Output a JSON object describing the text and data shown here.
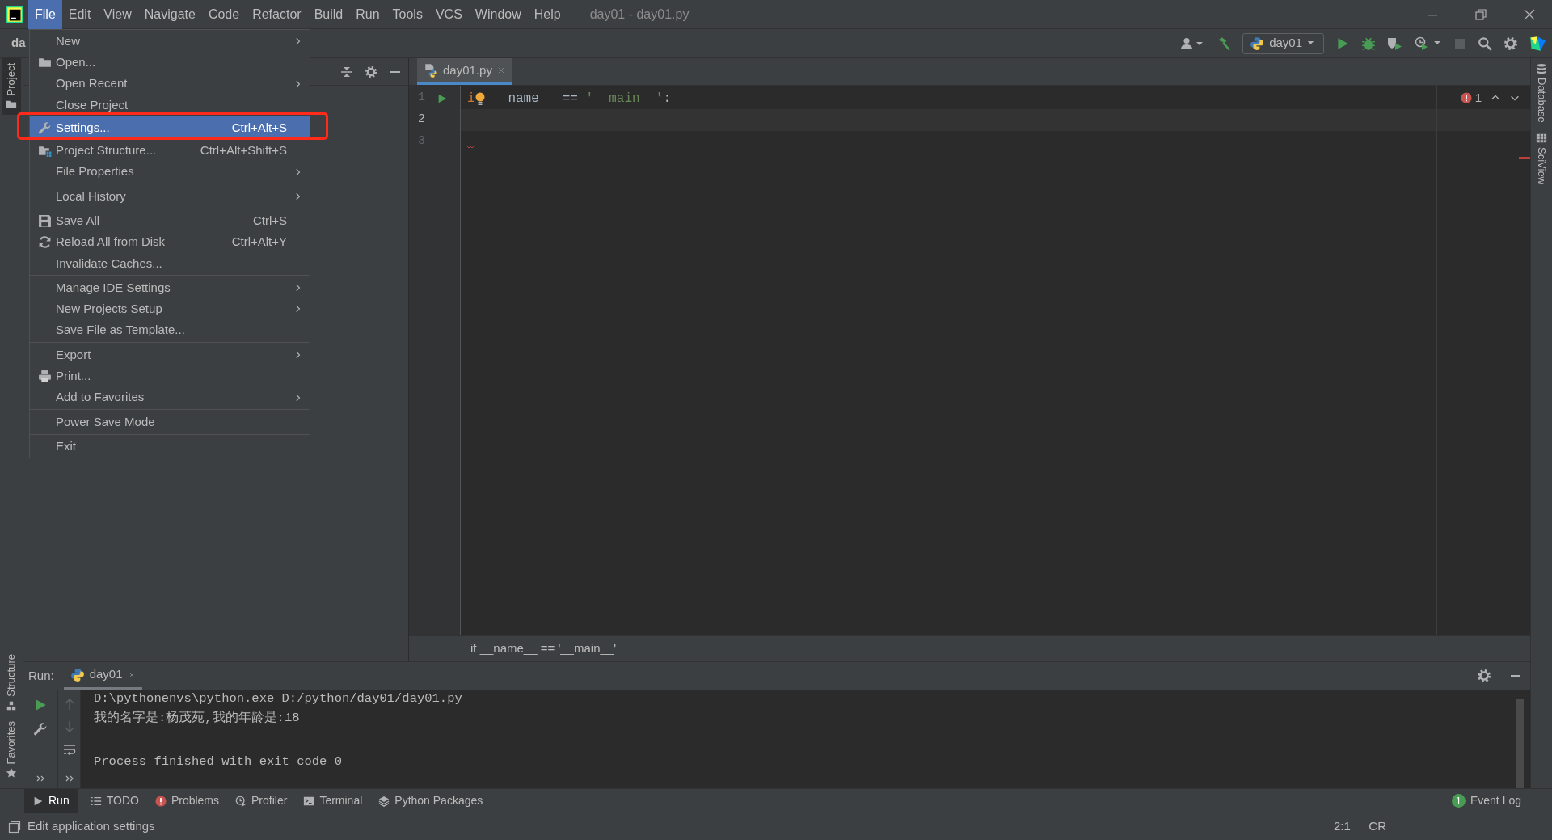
{
  "window": {
    "title": "day01 - day01.py"
  },
  "menu_bar": [
    {
      "label": "File",
      "selected": true
    },
    {
      "label": "Edit",
      "selected": false
    },
    {
      "label": "View",
      "selected": false
    },
    {
      "label": "Navigate",
      "selected": false
    },
    {
      "label": "Code",
      "selected": false
    },
    {
      "label": "Refactor",
      "selected": false
    },
    {
      "label": "Build",
      "selected": false
    },
    {
      "label": "Run",
      "selected": false
    },
    {
      "label": "Tools",
      "selected": false
    },
    {
      "label": "VCS",
      "selected": false
    },
    {
      "label": "Window",
      "selected": false
    },
    {
      "label": "Help",
      "selected": false
    }
  ],
  "navigation_bar": {
    "breadcrumb": "da"
  },
  "toolbar": {
    "run_configuration": "day01"
  },
  "file_menu": [
    {
      "kind": "item",
      "label": "New",
      "submenu": true,
      "selected": false
    },
    {
      "kind": "item",
      "label": "Open...",
      "submenu": false,
      "selected": false
    },
    {
      "kind": "item",
      "label": "Open Recent",
      "submenu": true,
      "selected": false
    },
    {
      "kind": "item",
      "label": "Close Project",
      "submenu": false,
      "selected": false
    },
    {
      "kind": "item",
      "label": "Settings...",
      "shortcut": "Ctrl+Alt+S",
      "submenu": false,
      "selected": true
    },
    {
      "kind": "item",
      "label": "Project Structure...",
      "shortcut": "Ctrl+Alt+Shift+S",
      "submenu": false,
      "selected": false
    },
    {
      "kind": "item",
      "label": "File Properties",
      "submenu": true,
      "selected": false
    },
    {
      "kind": "separator"
    },
    {
      "kind": "item",
      "label": "Local History",
      "submenu": true,
      "selected": false
    },
    {
      "kind": "separator"
    },
    {
      "kind": "item",
      "label": "Save All",
      "shortcut": "Ctrl+S",
      "submenu": false,
      "selected": false
    },
    {
      "kind": "item",
      "label": "Reload All from Disk",
      "shortcut": "Ctrl+Alt+Y",
      "submenu": false,
      "selected": false
    },
    {
      "kind": "item",
      "label": "Invalidate Caches...",
      "submenu": false,
      "selected": false
    },
    {
      "kind": "separator"
    },
    {
      "kind": "item",
      "label": "Manage IDE Settings",
      "submenu": true,
      "selected": false
    },
    {
      "kind": "item",
      "label": "New Projects Setup",
      "submenu": true,
      "selected": false
    },
    {
      "kind": "item",
      "label": "Save File as Template...",
      "submenu": false,
      "selected": false
    },
    {
      "kind": "separator"
    },
    {
      "kind": "item",
      "label": "Export",
      "submenu": true,
      "selected": false
    },
    {
      "kind": "item",
      "label": "Print...",
      "submenu": false,
      "selected": false
    },
    {
      "kind": "item",
      "label": "Add to Favorites",
      "submenu": true,
      "selected": false
    },
    {
      "kind": "separator"
    },
    {
      "kind": "item",
      "label": "Power Save Mode",
      "submenu": false,
      "selected": false
    },
    {
      "kind": "separator"
    },
    {
      "kind": "item",
      "label": "Exit",
      "submenu": false,
      "selected": false
    }
  ],
  "left_stripe": [
    {
      "label": "Project",
      "selected": true
    },
    {
      "label": "Structure",
      "selected": false
    },
    {
      "label": "Favorites",
      "selected": false
    }
  ],
  "right_stripe": [
    {
      "label": "Database"
    },
    {
      "label": "SciView"
    }
  ],
  "editor": {
    "tabs": [
      {
        "label": "day01.py",
        "selected": true
      }
    ],
    "lines": [
      {
        "number": "1",
        "runnable": true,
        "intention": true,
        "current": false,
        "error_mark": false,
        "tokens": [
          {
            "kind": "keyword",
            "text": "i"
          },
          {
            "kind": "plain",
            "text": " __name__ == "
          },
          {
            "kind": "string",
            "text": "'__main__'"
          },
          {
            "kind": "plain",
            "text": ":"
          }
        ]
      },
      {
        "number": "2",
        "runnable": false,
        "intention": false,
        "current": true,
        "error_mark": false
      },
      {
        "number": "3",
        "runnable": false,
        "intention": false,
        "current": false,
        "error_mark": true
      }
    ],
    "problems_count": "1",
    "breadcrumb": "if __name__ == '__main__'"
  },
  "run_panel": {
    "label": "Run:",
    "tabs": [
      {
        "label": "day01",
        "selected": true
      }
    ],
    "output": [
      {
        "kind": "command",
        "text": "D:\\pythonenvs\\python.exe D:/python/day01/day01.py"
      },
      {
        "kind": "stdout",
        "text": "我的名字是:杨茂苑,我的年龄是:18"
      },
      {
        "kind": "exit",
        "text": "Process finished with exit code 0"
      }
    ]
  },
  "tool_stripe": [
    {
      "label": "Run",
      "selected": true
    },
    {
      "label": "TODO",
      "selected": false
    },
    {
      "label": "Problems",
      "selected": false
    },
    {
      "label": "Profiler",
      "selected": false
    },
    {
      "label": "Terminal",
      "selected": false
    },
    {
      "label": "Python Packages",
      "selected": false
    }
  ],
  "event_log": {
    "label": "Event Log",
    "count": "1"
  },
  "status_bar": {
    "message": "Edit application settings",
    "position": "2:1",
    "line_separator": "CR"
  }
}
